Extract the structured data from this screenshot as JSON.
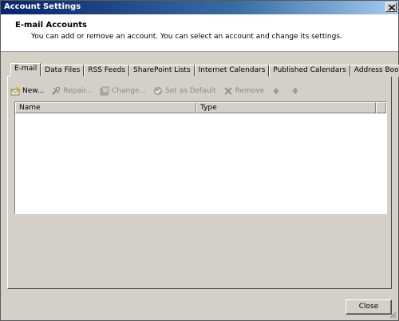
{
  "window": {
    "title": "Account Settings"
  },
  "header": {
    "title": "E-mail Accounts",
    "description": "You can add or remove an account. You can select an account and change its settings."
  },
  "tabs": [
    {
      "label": "E-mail",
      "active": true
    },
    {
      "label": "Data Files",
      "active": false
    },
    {
      "label": "RSS Feeds",
      "active": false
    },
    {
      "label": "SharePoint Lists",
      "active": false
    },
    {
      "label": "Internet Calendars",
      "active": false
    },
    {
      "label": "Published Calendars",
      "active": false
    },
    {
      "label": "Address Books",
      "active": false
    }
  ],
  "toolbar": {
    "new_label": "New...",
    "repair_label": "Repair...",
    "change_label": "Change...",
    "default_label": "Set as Default",
    "remove_label": "Remove"
  },
  "list": {
    "columns": [
      "Name",
      "Type"
    ],
    "rows": []
  },
  "footer": {
    "close_label": "Close"
  }
}
